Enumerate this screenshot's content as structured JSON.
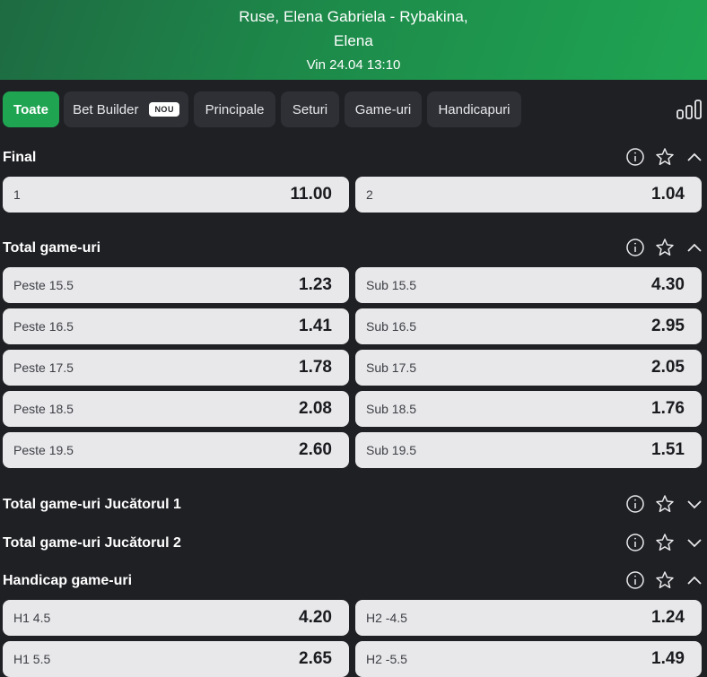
{
  "header": {
    "title_line1": "Ruse, Elena Gabriela - Rybakina,",
    "title_line2": "Elena",
    "datetime": "Vin 24.04 13:10"
  },
  "tabs": [
    {
      "label": "Toate",
      "active": true
    },
    {
      "label": "Bet Builder",
      "badge": "NOU"
    },
    {
      "label": "Principale"
    },
    {
      "label": "Seturi"
    },
    {
      "label": "Game-uri"
    },
    {
      "label": "Handicapuri"
    }
  ],
  "colors": {
    "accent": "#1fa552",
    "background": "#1f2024",
    "tab_bg": "#2e3036",
    "odd_bg": "#e8e8ea"
  },
  "sections": {
    "final": {
      "title": "Final",
      "expanded": true,
      "odds": [
        {
          "label": "1",
          "value": "11.00"
        },
        {
          "label": "2",
          "value": "1.04"
        }
      ]
    },
    "total_games": {
      "title": "Total game-uri",
      "expanded": true,
      "rows": [
        [
          {
            "label": "Peste 15.5",
            "value": "1.23"
          },
          {
            "label": "Sub 15.5",
            "value": "4.30"
          }
        ],
        [
          {
            "label": "Peste 16.5",
            "value": "1.41"
          },
          {
            "label": "Sub 16.5",
            "value": "2.95"
          }
        ],
        [
          {
            "label": "Peste 17.5",
            "value": "1.78"
          },
          {
            "label": "Sub 17.5",
            "value": "2.05"
          }
        ],
        [
          {
            "label": "Peste 18.5",
            "value": "2.08"
          },
          {
            "label": "Sub 18.5",
            "value": "1.76"
          }
        ],
        [
          {
            "label": "Peste 19.5",
            "value": "2.60"
          },
          {
            "label": "Sub 19.5",
            "value": "1.51"
          }
        ]
      ]
    },
    "total_games_p1": {
      "title": "Total game-uri Jucătorul 1",
      "expanded": false
    },
    "total_games_p2": {
      "title": "Total game-uri Jucătorul 2",
      "expanded": false
    },
    "handicap_games": {
      "title": "Handicap game-uri",
      "expanded": true,
      "rows": [
        [
          {
            "label": "H1 4.5",
            "value": "4.20"
          },
          {
            "label": "H2 -4.5",
            "value": "1.24"
          }
        ],
        [
          {
            "label": "H1 5.5",
            "value": "2.65"
          },
          {
            "label": "H2 -5.5",
            "value": "1.49"
          }
        ]
      ]
    }
  },
  "icons": {
    "info": "info-icon",
    "favorite": "star-icon",
    "collapse": "chevron-up-icon",
    "expand": "chevron-down-icon",
    "stats": "bar-chart-icon"
  }
}
